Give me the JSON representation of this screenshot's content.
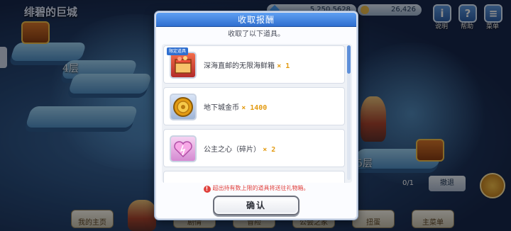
{
  "scene": {
    "location_title": "绯碧的巨城",
    "floor_labels": [
      "4层",
      "5层"
    ],
    "currency": [
      {
        "icon": "gem-icon",
        "value": "5,250,5628"
      },
      {
        "icon": "stamina-icon",
        "value": "26,426"
      }
    ],
    "top_menu": [
      {
        "icon": "info-icon",
        "label": "说明"
      },
      {
        "icon": "help-icon",
        "label": "帮助"
      },
      {
        "icon": "menu-icon",
        "label": "菜单"
      }
    ],
    "side_buttons": {
      "counter": "0/1",
      "retreat": "撤退"
    },
    "bottom_tabs": [
      "我的主页",
      "剧情",
      "冒险",
      "公会之家",
      "扭蛋",
      "主菜单"
    ]
  },
  "modal": {
    "title": "收取报酬",
    "subtitle": "收取了以下道具。",
    "rewards": [
      {
        "name": "深海直邮的无限海鲜箱",
        "quantity": "× 1",
        "icon": "seafood-box-icon",
        "badge": "限定道具"
      },
      {
        "name": "地下城金币",
        "quantity": "× 1400",
        "icon": "dungeon-coin-icon",
        "badge": ""
      },
      {
        "name": "公主之心（碎片）",
        "quantity": "× 2",
        "icon": "princess-heart-icon",
        "badge": ""
      }
    ],
    "notice": "超出持有数上限的道具将送往礼物箱。",
    "confirm_label": "确认"
  },
  "colors": {
    "title_bar": "#2f6fd0",
    "quantity": "#e39b12",
    "notice": "#e0413d"
  }
}
